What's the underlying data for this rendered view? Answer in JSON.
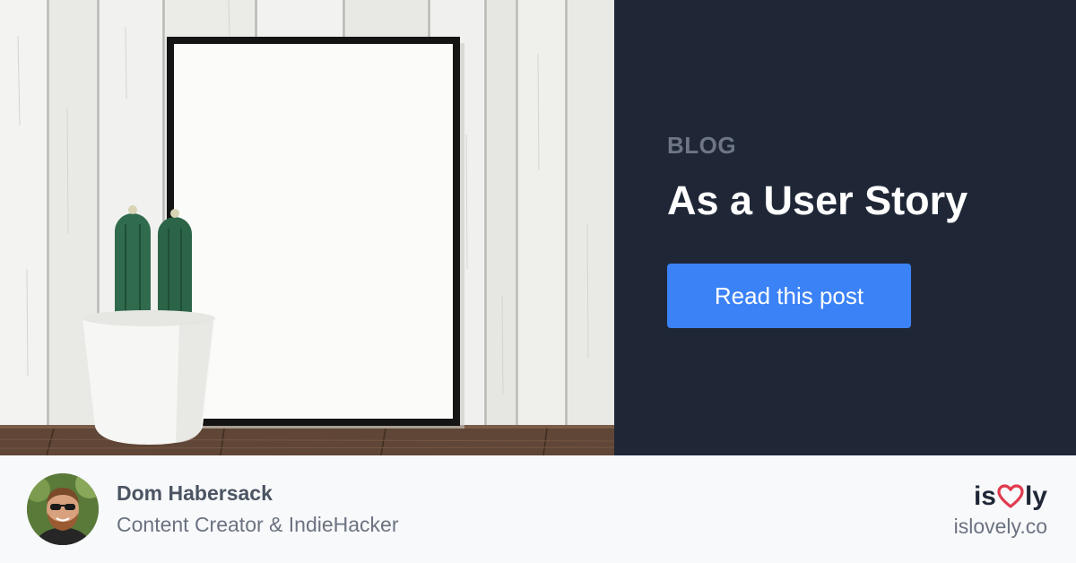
{
  "hero": {
    "eyebrow": "BLOG",
    "title": "As a User Story",
    "cta_label": "Read this post"
  },
  "author": {
    "name": "Dom Habersack",
    "role": "Content Creator & IndieHacker"
  },
  "brand": {
    "logo_prefix": "is",
    "logo_suffix": "ly",
    "logo_heart_icon": "heart-icon",
    "url": "islovely.co"
  },
  "colors": {
    "panel_background": "#1f2737",
    "eyebrow": "#6e7685",
    "title": "#ffffff",
    "button": "#3b82f6",
    "footer_background": "#f8f9fb",
    "heart": "#e03b4e"
  }
}
